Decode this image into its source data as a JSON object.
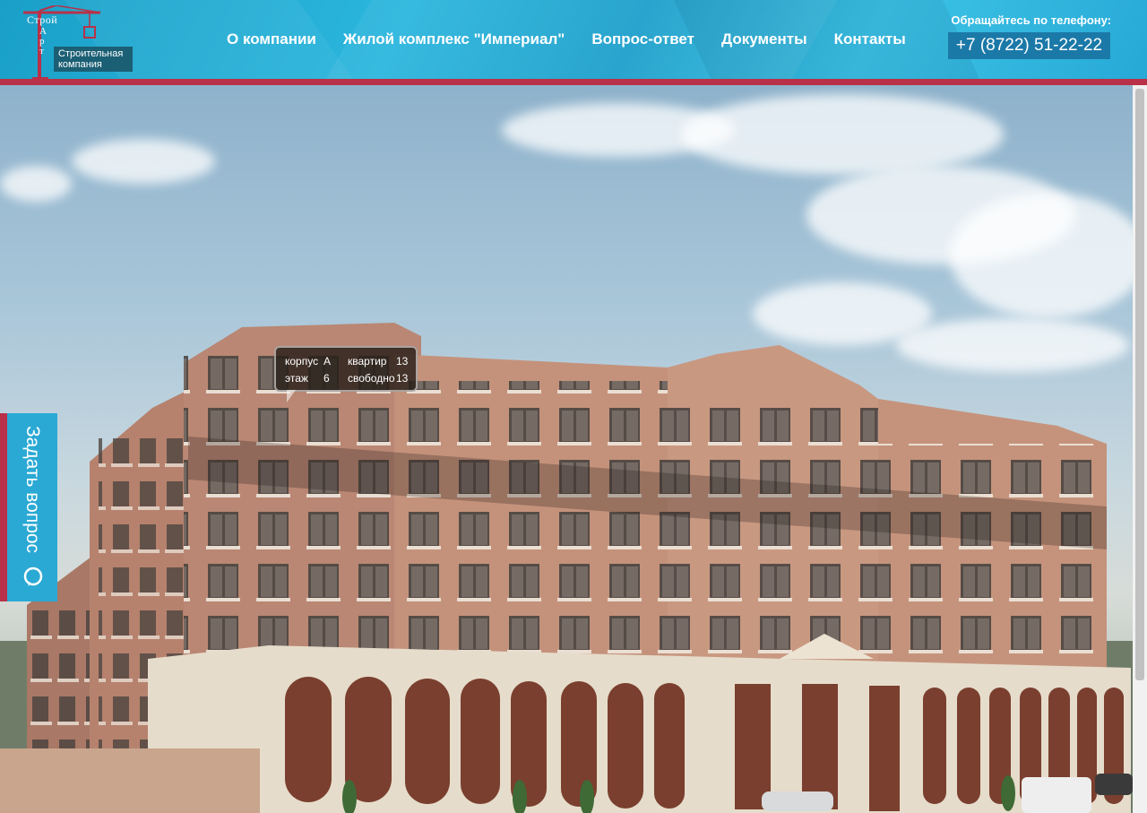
{
  "logo": {
    "line1": "Строй",
    "line2": "Арт",
    "tagline": "Строительная компания",
    "icon": "crane-icon"
  },
  "nav": {
    "items": [
      {
        "label": "О компании"
      },
      {
        "label": "Жилой комплекс \"Империал\""
      },
      {
        "label": "Вопрос-ответ"
      },
      {
        "label": "Документы"
      },
      {
        "label": "Контакты"
      }
    ]
  },
  "contact": {
    "label": "Обращайтесь по телефону:",
    "phone": "+7 (8722) 51-22-22"
  },
  "side_button": {
    "label": "Задать вопрос",
    "icon": "question-chat-icon"
  },
  "tooltip": {
    "korpus_label": "корпус",
    "korpus_value": "А",
    "etazh_label": "этаж",
    "etazh_value": "6",
    "kvartir_label": "квартир",
    "kvartir_value": "13",
    "svobodno_label": "свободно",
    "svobodno_value": "13"
  },
  "colors": {
    "header": "#27a9d6",
    "accent_red": "#b83148",
    "phone_box": "#1b79a8"
  }
}
